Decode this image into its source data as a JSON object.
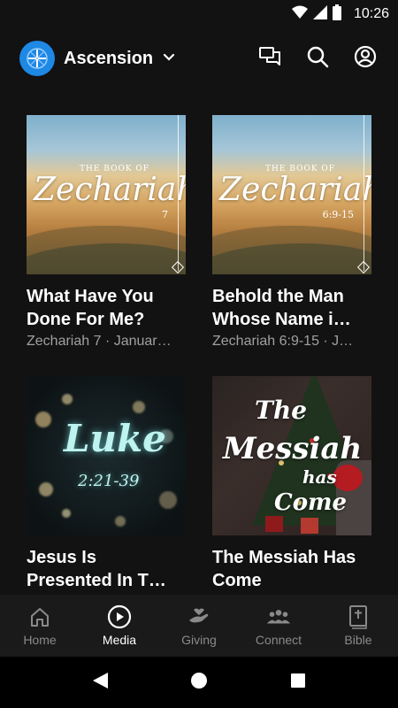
{
  "status_bar": {
    "time": "10:26"
  },
  "header": {
    "app_name": "Ascension"
  },
  "media_items": [
    {
      "title": "What Have You Done For Me?",
      "meta": "Zechariah 7 · Januar…",
      "thumb": {
        "book_label": "THE BOOK OF",
        "word": "Zechariah",
        "ref": "7"
      }
    },
    {
      "title": "Behold the Man Whose Name i…",
      "meta": "Zechariah 6:9-15 · J…",
      "thumb": {
        "book_label": "THE BOOK OF",
        "word": "Zechariah",
        "ref": "6:9-15"
      }
    },
    {
      "title": "Jesus Is Presented In T…",
      "meta": "",
      "thumb": {
        "word": "Luke",
        "ref": "2:21-39"
      }
    },
    {
      "title": "The Messiah Has Come",
      "meta": "",
      "thumb": {
        "line1": "The",
        "line2": "Messiah",
        "line3": "has",
        "line4": "Come"
      }
    }
  ],
  "bottom_nav": [
    {
      "label": "Home",
      "icon": "home-icon"
    },
    {
      "label": "Media",
      "icon": "play-circle-icon",
      "active": true
    },
    {
      "label": "Giving",
      "icon": "giving-hand-icon"
    },
    {
      "label": "Connect",
      "icon": "group-icon"
    },
    {
      "label": "Bible",
      "icon": "bible-icon"
    }
  ],
  "colors": {
    "background": "#121212",
    "logo_blue": "#1e88e5",
    "inactive": "#8a8a8a"
  }
}
